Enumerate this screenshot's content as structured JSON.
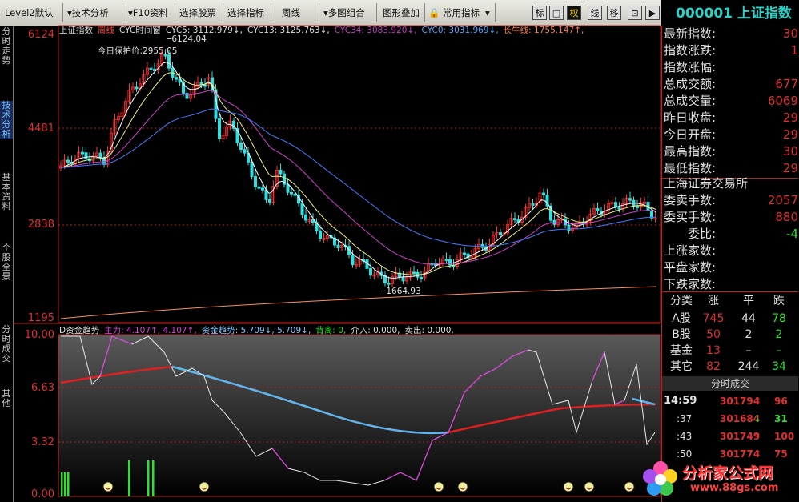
{
  "toolbar": {
    "items": [
      "Level2默认",
      "技术分析",
      "F10资料",
      "选择股票",
      "选择指标",
      "周线",
      "多图组合",
      "图形叠加",
      "常用指标"
    ],
    "mini": [
      "标",
      "□",
      "权",
      "线",
      "移",
      "⊡",
      "▶"
    ]
  },
  "stock": {
    "code": "000001",
    "name": "上证指数"
  },
  "vtabs": [
    "分时走势",
    "技术分析",
    "基本资料",
    "个股全景",
    "分时成交",
    "其他"
  ],
  "main_chart": {
    "y_labels": [
      "6124",
      "4481",
      "2838",
      "1195"
    ],
    "head": [
      {
        "t": "上证指数",
        "c": "#e0e0e0"
      },
      {
        "t": "周线",
        "c": "#ff4040"
      },
      {
        "t": "CYC时间窗",
        "c": "#e0e0e0"
      },
      {
        "t": "CYC5: 3112.979↓,",
        "c": "#e0e0e0"
      },
      {
        "t": "CYC13: 3125.763↓,",
        "c": "#e0e0e0"
      },
      {
        "t": "CYC34: 3083.920↓,",
        "c": "#c040c0"
      },
      {
        "t": "CYC0: 3031.969↓,",
        "c": "#4aa8ff"
      },
      {
        "t": "长牛线: 1755.147↑,",
        "c": "#ff8040"
      }
    ],
    "high_label": "6124.04",
    "low_label": "1664.93",
    "protect_label": "今日保护价:2955.05"
  },
  "indicator": {
    "y_labels": [
      "10.00",
      "6.63",
      "3.32",
      "0.00"
    ],
    "head": [
      {
        "t": "D资金趋势",
        "c": "#e0e0e0"
      },
      {
        "t": "主力: 4.107↑, 4.107↑,",
        "c": "#e040e0"
      },
      {
        "t": "资金趋势: 5.709↓, 5.709↓,",
        "c": "#7ec8ff"
      },
      {
        "t": "背离: 0,",
        "c": "#30e030"
      },
      {
        "t": "介入: 0.000,",
        "c": "#e0e0e0"
      },
      {
        "t": "卖出: 0.000,",
        "c": "#e0e0e0"
      }
    ]
  },
  "quote": {
    "rows": [
      {
        "k": "最新指数:",
        "v": "30"
      },
      {
        "k": "指数涨跌:",
        "v": "1"
      },
      {
        "k": "指数涨幅:",
        "v": ""
      },
      {
        "k": "总成交额:",
        "v": "677"
      },
      {
        "k": "总成交量:",
        "v": "6069"
      },
      {
        "k": "昨日收盘:",
        "v": "29"
      },
      {
        "k": "今日开盘:",
        "v": "29"
      },
      {
        "k": "最高指数:",
        "v": "30"
      },
      {
        "k": "最低指数:",
        "v": "29"
      }
    ],
    "exchange": "上海证券交易所",
    "rows2": [
      {
        "k": "委卖手数:",
        "v": "2057"
      },
      {
        "k": "委买手数:",
        "v": "880"
      },
      {
        "k": "委比:",
        "v": "-4"
      },
      {
        "k": "上涨家数:",
        "v": ""
      },
      {
        "k": "平盘家数:",
        "v": ""
      },
      {
        "k": "下跌家数:",
        "v": ""
      }
    ],
    "table_head": [
      "分类",
      "涨",
      "平",
      "跌"
    ],
    "table": [
      {
        "n": "A股",
        "a": "745",
        "b": "44",
        "c": "78"
      },
      {
        "n": "B股",
        "a": "50",
        "b": "2",
        "c": "2"
      },
      {
        "n": "基金",
        "a": "13",
        "b": "–",
        "c": "–"
      },
      {
        "n": "其它",
        "a": "82",
        "b": "244",
        "c": "34"
      }
    ],
    "ticks_title": "分时成交",
    "ticks": [
      {
        "t": "14:59",
        "p": "301794",
        "a": "↑",
        "v": "96"
      },
      {
        "t": ":37",
        "p": "301684",
        "a": "↓",
        "v": "31"
      },
      {
        "t": ":43",
        "p": "301749",
        "a": "↑",
        "v": "100"
      },
      {
        "t": ":50",
        "p": "301774",
        "a": "↑",
        "v": "75"
      }
    ]
  },
  "watermark": {
    "title": "分析家公式网",
    "url": "www.88gs.com"
  },
  "colors": {
    "up": "#ff3030",
    "down": "#30e0e0",
    "bg": "#000000",
    "accent": "#2ad1c8"
  }
}
